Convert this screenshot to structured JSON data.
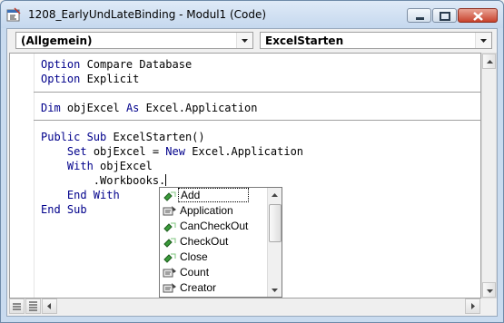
{
  "window": {
    "title": "1208_EarlyUndLateBinding - Modul1 (Code)",
    "icons": {
      "app": "vba-module-icon",
      "minimize": "minimize-icon",
      "maximize": "maximize-icon",
      "close": "close-icon"
    },
    "colors": {
      "keyword": "#00008b",
      "text": "#000000",
      "close_button": "#c8432d",
      "title_bar": "#c5d8ee"
    }
  },
  "toolbar": {
    "object_combo": {
      "value": "(Allgemein)"
    },
    "procedure_combo": {
      "value": "ExcelStarten"
    }
  },
  "code": {
    "section1": [
      {
        "keyword": "Option",
        "rest": " Compare Database"
      },
      {
        "keyword": "Option",
        "rest": " Explicit"
      }
    ],
    "section2": [
      {
        "keyword": "Dim",
        "rest": " objExcel ",
        "keyword2": "As",
        "rest2": " Excel.Application"
      }
    ],
    "section3": [
      {
        "indent": "",
        "keyword": "Public Sub",
        "rest": " ExcelStarten()"
      },
      {
        "indent": "    ",
        "keyword": "Set",
        "rest": " objExcel = ",
        "keyword2": "New",
        "rest2": " Excel.Application"
      },
      {
        "indent": "    ",
        "keyword": "With",
        "rest": " objExcel"
      },
      {
        "indent": "        ",
        "keyword": "",
        "rest": ".Workbooks."
      },
      {
        "indent": "    ",
        "keyword": "End With",
        "rest": ""
      },
      {
        "indent": "",
        "keyword": "End Sub",
        "rest": ""
      }
    ]
  },
  "autocomplete": {
    "selected": "Add",
    "items": [
      {
        "label": "Add",
        "icon": "method-icon"
      },
      {
        "label": "Application",
        "icon": "property-icon"
      },
      {
        "label": "CanCheckOut",
        "icon": "method-icon"
      },
      {
        "label": "CheckOut",
        "icon": "method-icon"
      },
      {
        "label": "Close",
        "icon": "method-icon"
      },
      {
        "label": "Count",
        "icon": "property-icon"
      },
      {
        "label": "Creator",
        "icon": "property-icon"
      }
    ]
  },
  "status_icons": {
    "procedure_view": "procedure-view-icon",
    "full_module_view": "full-module-view-icon"
  }
}
